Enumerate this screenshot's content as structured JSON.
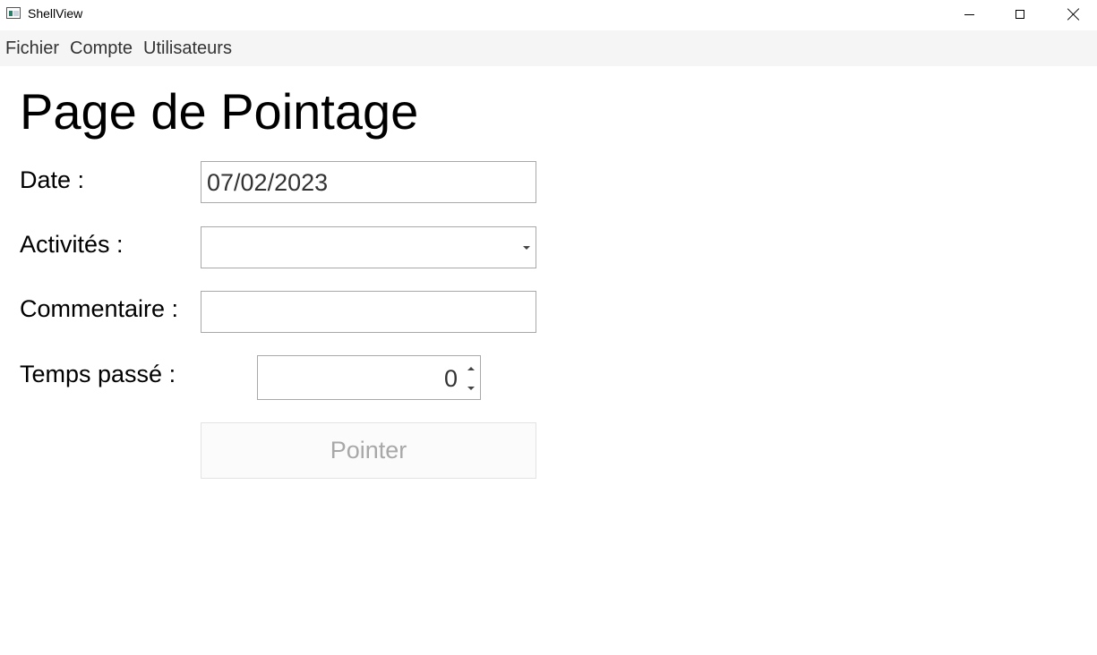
{
  "window": {
    "title": "ShellView",
    "app_icon": "window-app-icon",
    "controls": [
      "minimize-icon",
      "maximize-icon",
      "close-icon"
    ]
  },
  "menu": {
    "items": [
      "Fichier",
      "Compte",
      "Utilisateurs"
    ]
  },
  "page": {
    "title": "Page de Pointage"
  },
  "form": {
    "date_label": "Date :",
    "date_value": "07/02/2023",
    "activities_label": "Activités :",
    "activities_value": "",
    "comment_label": "Commentaire :",
    "comment_value": "",
    "time_label": "Temps passé :",
    "time_value": "0",
    "submit_label": "Pointer",
    "submit_enabled": false
  }
}
